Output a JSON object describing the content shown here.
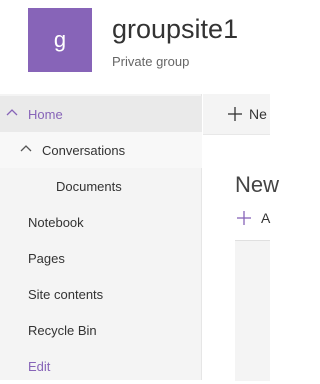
{
  "site": {
    "logo_letter": "g",
    "title": "groupsite1",
    "subtitle": "Private group",
    "accent_color": "#8764b8"
  },
  "nav": {
    "home": "Home",
    "conversations": "Conversations",
    "documents": "Documents",
    "notebook": "Notebook",
    "pages": "Pages",
    "site_contents": "Site contents",
    "recycle_bin": "Recycle Bin",
    "edit": "Edit"
  },
  "commandbar": {
    "new_label": "Ne",
    "new_icon": "plus-icon"
  },
  "main": {
    "section_title": "New",
    "add_label": "A",
    "add_icon": "plus-icon"
  }
}
